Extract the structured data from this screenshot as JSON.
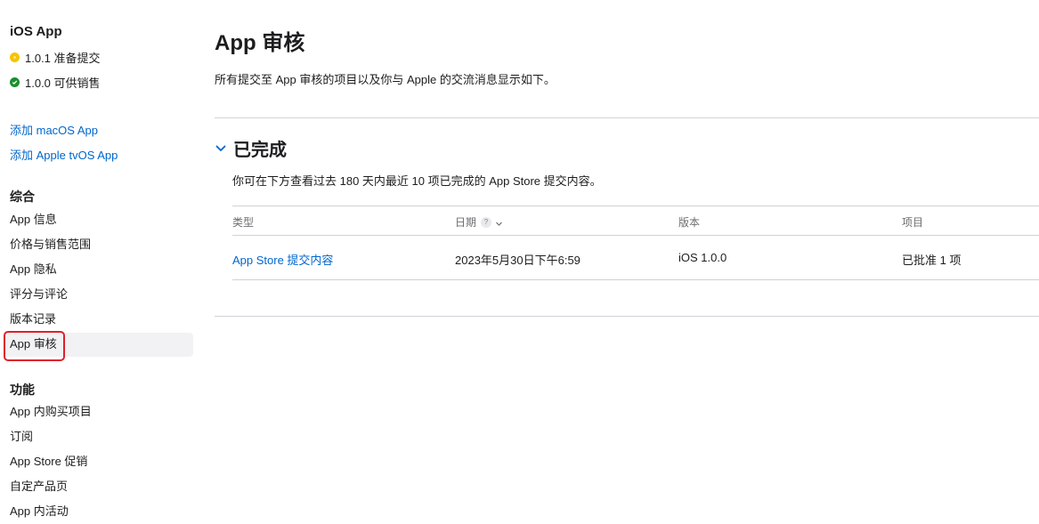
{
  "sidebar": {
    "app_title": "iOS App",
    "versions": [
      {
        "label": "1.0.1 准备提交",
        "status_color": "#f5c400",
        "status": "pending"
      },
      {
        "label": "1.0.0 可供销售",
        "status_color": "#1a8f2f",
        "status": "ready"
      }
    ],
    "add_links": [
      "添加 macOS App",
      "添加 Apple tvOS App"
    ],
    "general_title": "综合",
    "general_items": [
      "App 信息",
      "价格与销售范围",
      "App 隐私",
      "评分与评论",
      "版本记录",
      "App 审核"
    ],
    "active_item": "App 审核",
    "features_title": "功能",
    "feature_items": [
      "App 内购买项目",
      "订阅",
      "App Store 促销",
      "自定产品页",
      "App 内活动"
    ]
  },
  "main": {
    "title": "App 审核",
    "description": "所有提交至 App 审核的项目以及你与 Apple 的交流消息显示如下。",
    "section": {
      "title": "已完成",
      "description": "你可在下方查看过去 180 天内最近 10 项已完成的 App Store 提交内容。",
      "columns": [
        "类型",
        "日期",
        "版本",
        "项目"
      ],
      "help_glyph": "?",
      "rows": [
        {
          "type": "App Store 提交内容",
          "date": "2023年5月30日下午6:59",
          "version": "iOS 1.0.0",
          "items": "已批准 1 项"
        }
      ]
    }
  },
  "colors": {
    "link": "#0066cc",
    "highlight": "#e0202a",
    "divider": "#d2d2d7"
  }
}
